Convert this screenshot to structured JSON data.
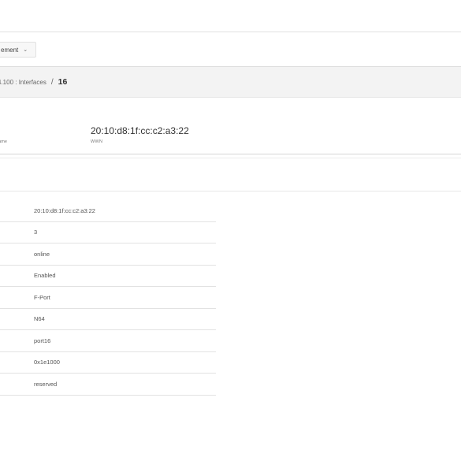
{
  "header": {
    "dropdown_label": "ement",
    "dropdown_chevron": "chevron-down-icon"
  },
  "breadcrumb": {
    "path": "4.100 : Interfaces",
    "separator": "/",
    "current": "16"
  },
  "summary": {
    "wwn_value": "20:10:d8:1f:cc:c2:a3:22",
    "wwn_label": "WWN",
    "name_label": "lame"
  },
  "properties": {
    "rows": [
      {
        "value": "20:10:d8:1f:cc:c2:a3:22"
      },
      {
        "value": "3"
      },
      {
        "value": "online"
      },
      {
        "value": "Enabled"
      },
      {
        "value": "F-Port"
      },
      {
        "value": "N64"
      },
      {
        "value": "port16"
      },
      {
        "value": "0x1e1000"
      },
      {
        "value": "reserved"
      }
    ]
  }
}
